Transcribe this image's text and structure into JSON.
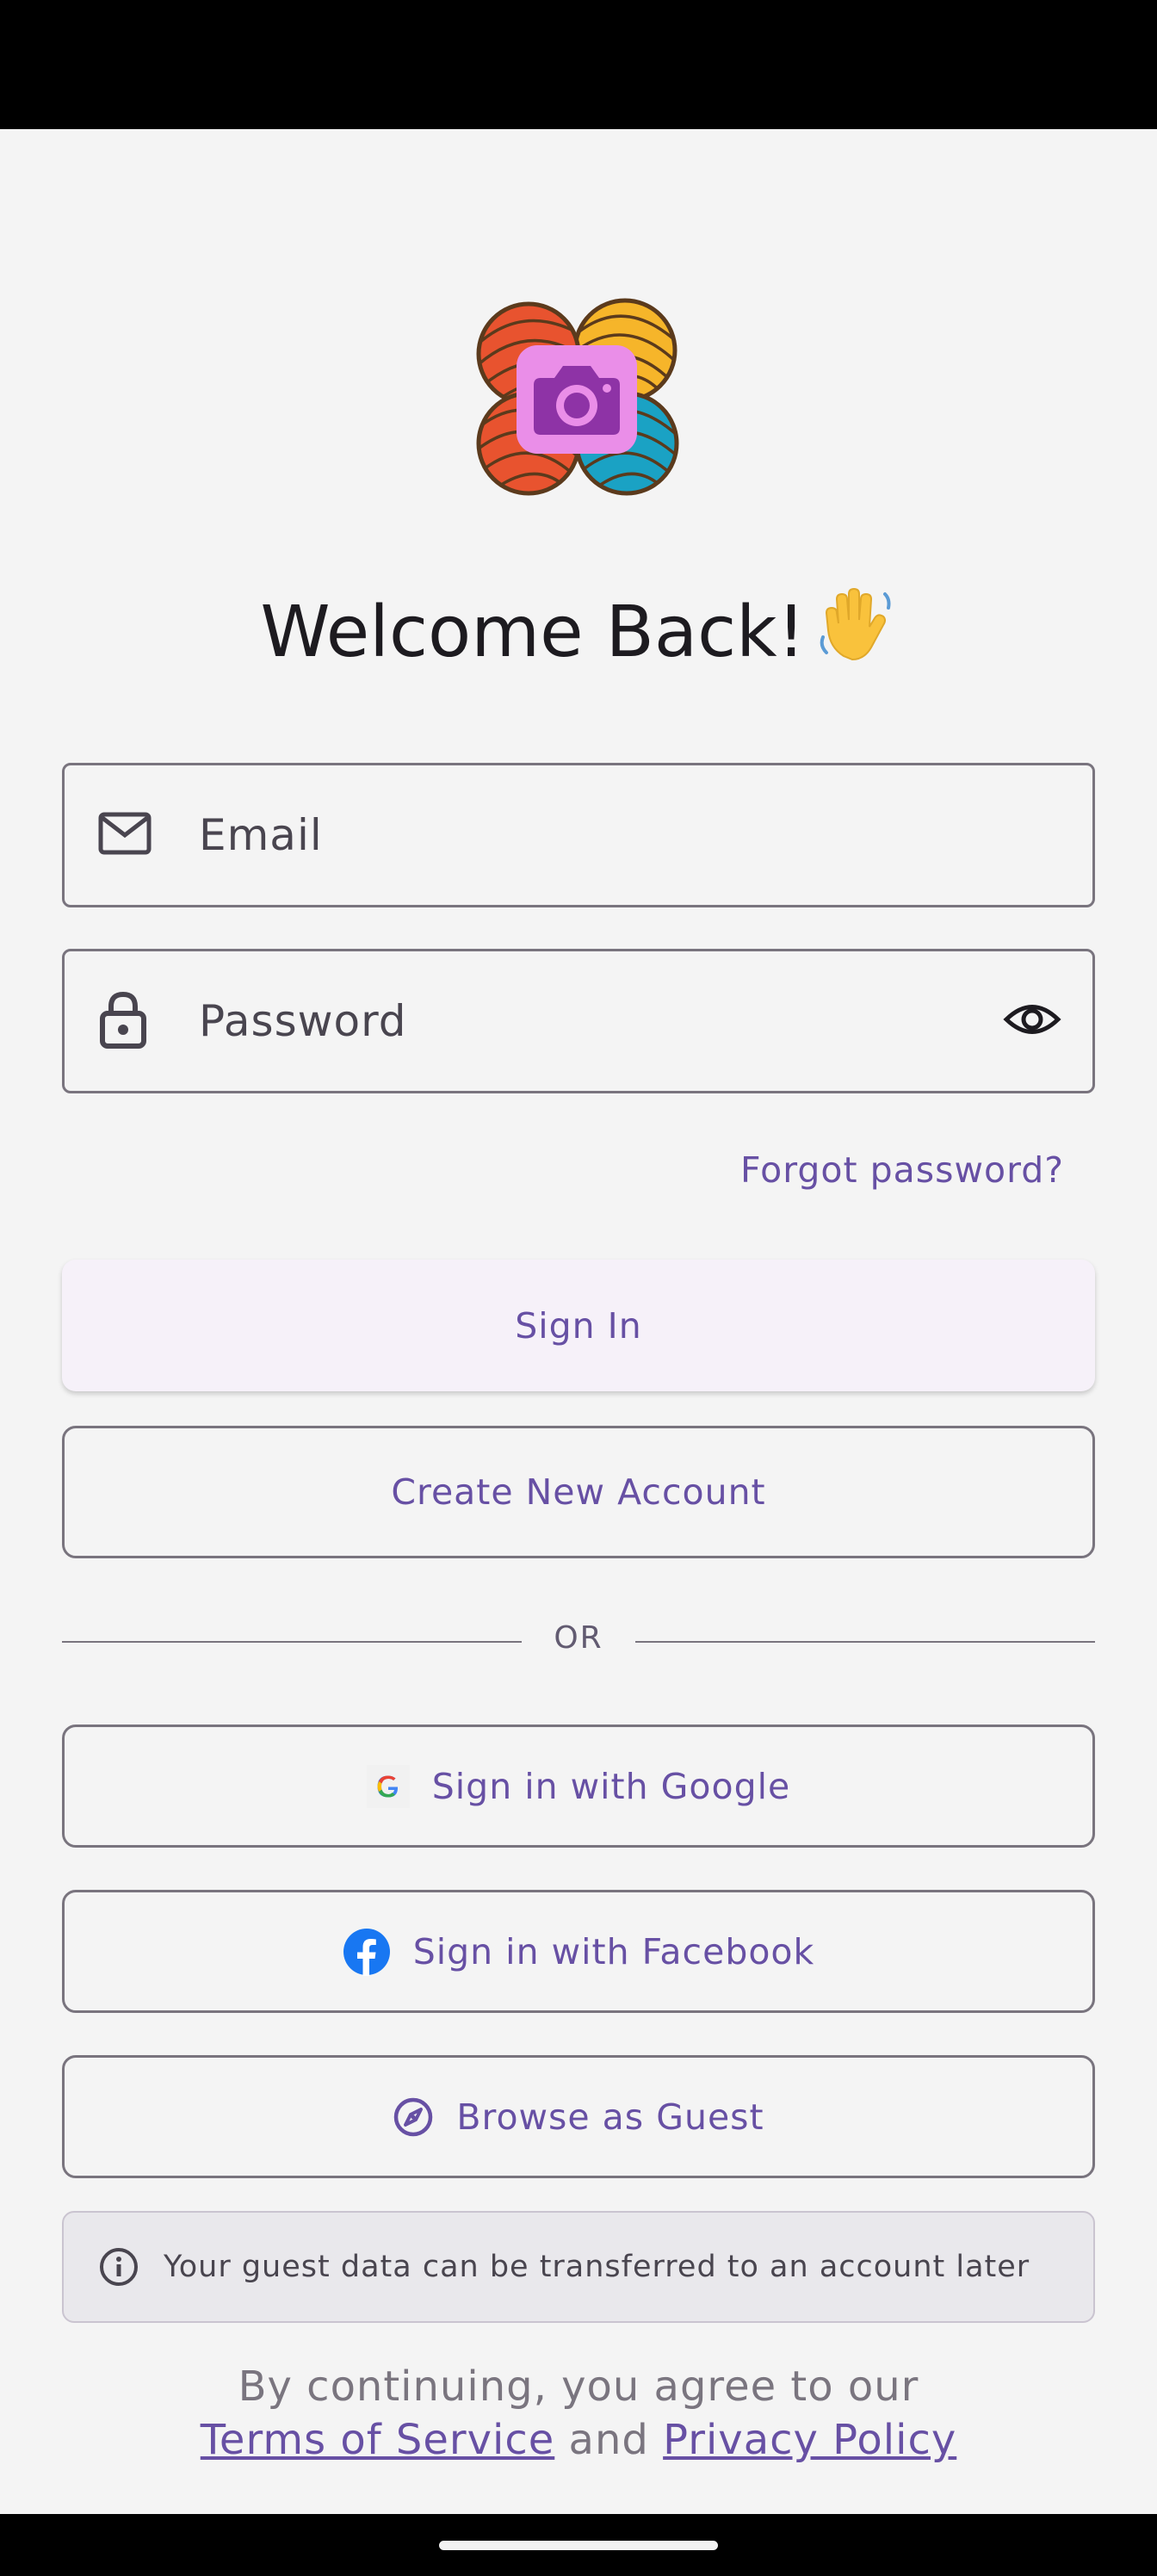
{
  "welcome": {
    "title": "Welcome Back!"
  },
  "email": {
    "placeholder": "Email"
  },
  "password": {
    "placeholder": "Password"
  },
  "forgot_password": "Forgot password?",
  "buttons": {
    "sign_in": "Sign In",
    "create_account": "Create New Account",
    "google": "Sign in with Google",
    "facebook": "Sign in with Facebook",
    "guest": "Browse as Guest"
  },
  "divider_text": "OR",
  "info_text": "Your guest data can be transferred to an account later",
  "terms": {
    "line1": "By continuing, you agree to our",
    "terms_link": "Terms of Service",
    "and": "and",
    "privacy_link": "Privacy Policy"
  },
  "colors": {
    "accent": "#6750a4",
    "background": "#f4f4f4",
    "outline": "#79747e",
    "facebook": "#1877f2"
  },
  "icons": [
    "app-logo",
    "waving-hand-icon",
    "mail-icon",
    "lock-icon",
    "eye-icon",
    "google-icon",
    "facebook-icon",
    "compass-icon",
    "info-icon"
  ]
}
